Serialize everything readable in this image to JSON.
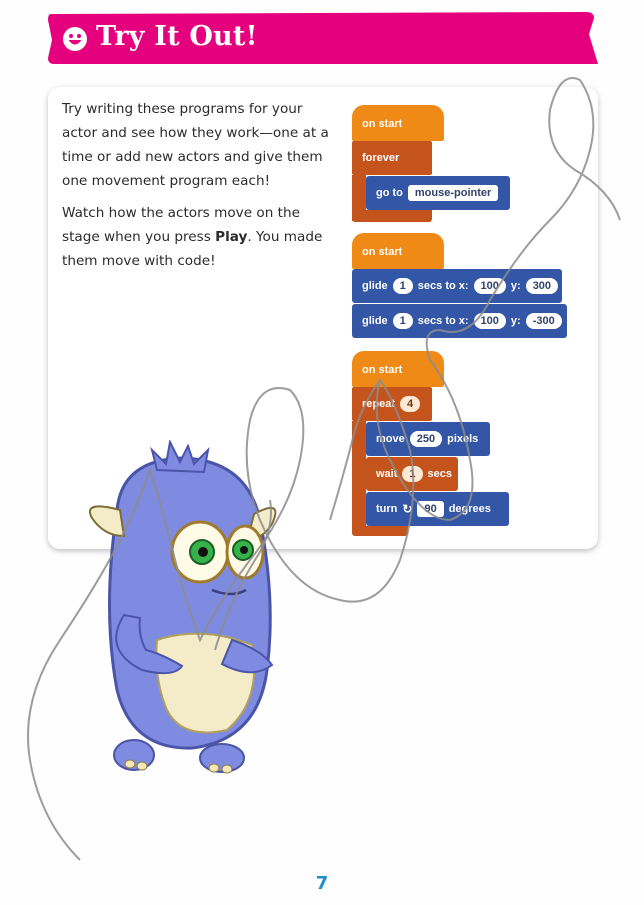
{
  "header": {
    "title": "Try It Out!",
    "icon": "smiley-face-icon",
    "color": "#e5007d"
  },
  "intro": {
    "paragraph1": "Try writing these programs for your actor and see how they work—one at a time or add new actors and give them one movement program each!",
    "paragraph2_before": "Watch how the actors move on the stage when you press ",
    "paragraph2_bold": "Play",
    "paragraph2_after": ". You made them move with code!"
  },
  "programs": {
    "p1": {
      "hat": "on start",
      "loop": "forever",
      "cmd": "go to",
      "target": "mouse-pointer"
    },
    "p2": {
      "hat": "on start",
      "glide1": {
        "verb": "glide",
        "secs": "1",
        "mid": "secs to x:",
        "x": "100",
        "ylabel": "y:",
        "y": "300"
      },
      "glide2": {
        "verb": "glide",
        "secs": "1",
        "mid": "secs to x:",
        "x": "100",
        "ylabel": "y:",
        "y": "-300"
      }
    },
    "p3": {
      "hat": "on start",
      "repeat": "repeat",
      "times": "4",
      "move": "move",
      "pixels_value": "250",
      "pixels": "pixels",
      "wait": "wait",
      "wait_value": "1",
      "secs": "secs",
      "turn": "turn",
      "turn_icon": "rotate-clockwise-icon",
      "degrees_value": "90",
      "degrees": "degrees"
    }
  },
  "colors": {
    "hat": "#f08a16",
    "control": "#c4541c",
    "motion": "#3356a7",
    "monster_body": "#7f8be0",
    "page_number": "#1e8fcc"
  },
  "page_number": "7"
}
